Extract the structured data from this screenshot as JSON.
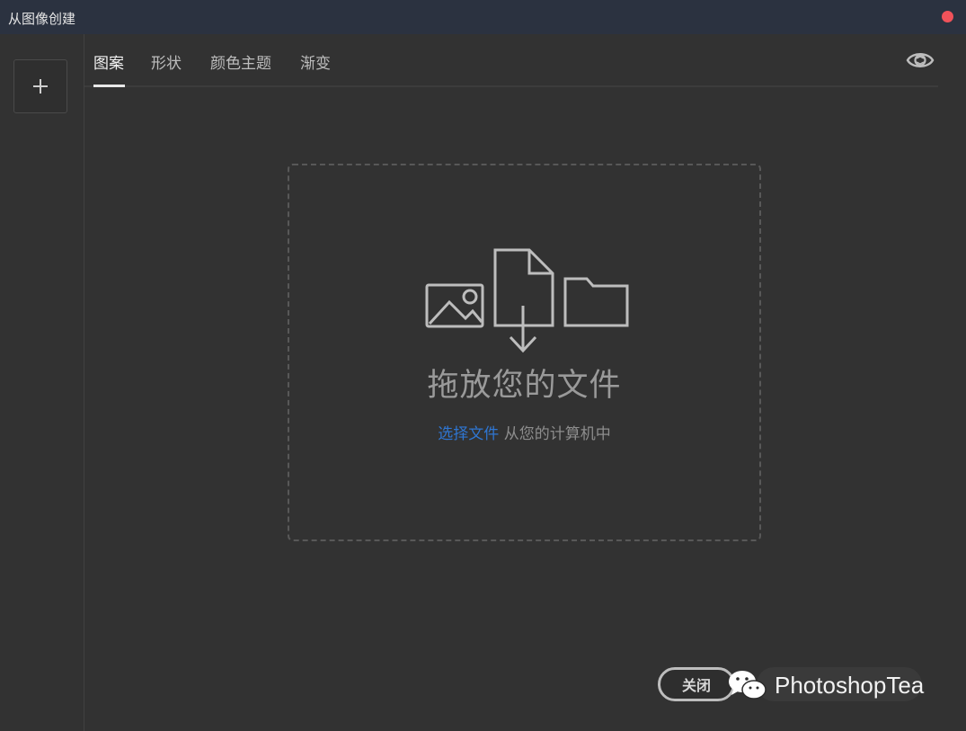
{
  "window": {
    "title": "从图像创建"
  },
  "tabs": [
    {
      "label": "图案",
      "active": true
    },
    {
      "label": "形状",
      "active": false
    },
    {
      "label": "颜色主题",
      "active": false
    },
    {
      "label": "渐变",
      "active": false
    }
  ],
  "dropzone": {
    "title": "拖放您的文件",
    "link_text": "选择文件",
    "suffix_text": " 从您的计算机中"
  },
  "footer": {
    "close_label": "关闭",
    "watermark": "PhotoshopTea"
  },
  "colors": {
    "accent_link": "#2f76d2",
    "close_dot": "#f0525a",
    "background": "#323232"
  },
  "icons": [
    "plus-icon",
    "eye-icon",
    "image-icon",
    "file-download-icon",
    "folder-icon",
    "wechat-icon"
  ]
}
